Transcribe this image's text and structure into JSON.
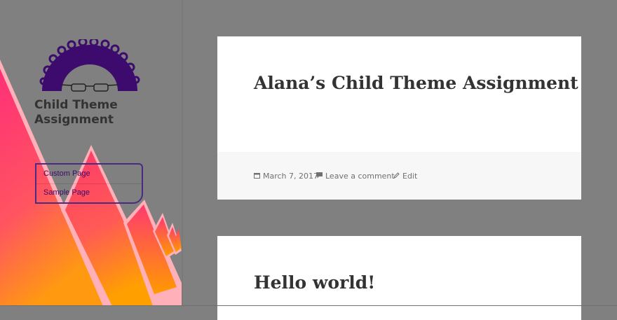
{
  "site": {
    "title": "Child Theme Assignment"
  },
  "nav": {
    "items": [
      {
        "label": "Custom Page"
      },
      {
        "label": "Sample Page"
      }
    ]
  },
  "posts": [
    {
      "title": "Alana’s Child Theme Assignment",
      "date": "March 7, 2017",
      "comment_link": "Leave a comment",
      "edit_link": "Edit"
    },
    {
      "title": "Hello world!"
    }
  ],
  "icons": {
    "logo": "arch-eyeglasses-logo",
    "date": "calendar-icon",
    "comment": "speech-bubble-icon",
    "edit": "pencil-icon"
  },
  "colors": {
    "background": "#808080",
    "logo_purple": "#3d0a6e",
    "triangle_pink": "#ff3a6e",
    "triangle_orange": "#ff9a00",
    "nav_border": "#4b2a82"
  }
}
